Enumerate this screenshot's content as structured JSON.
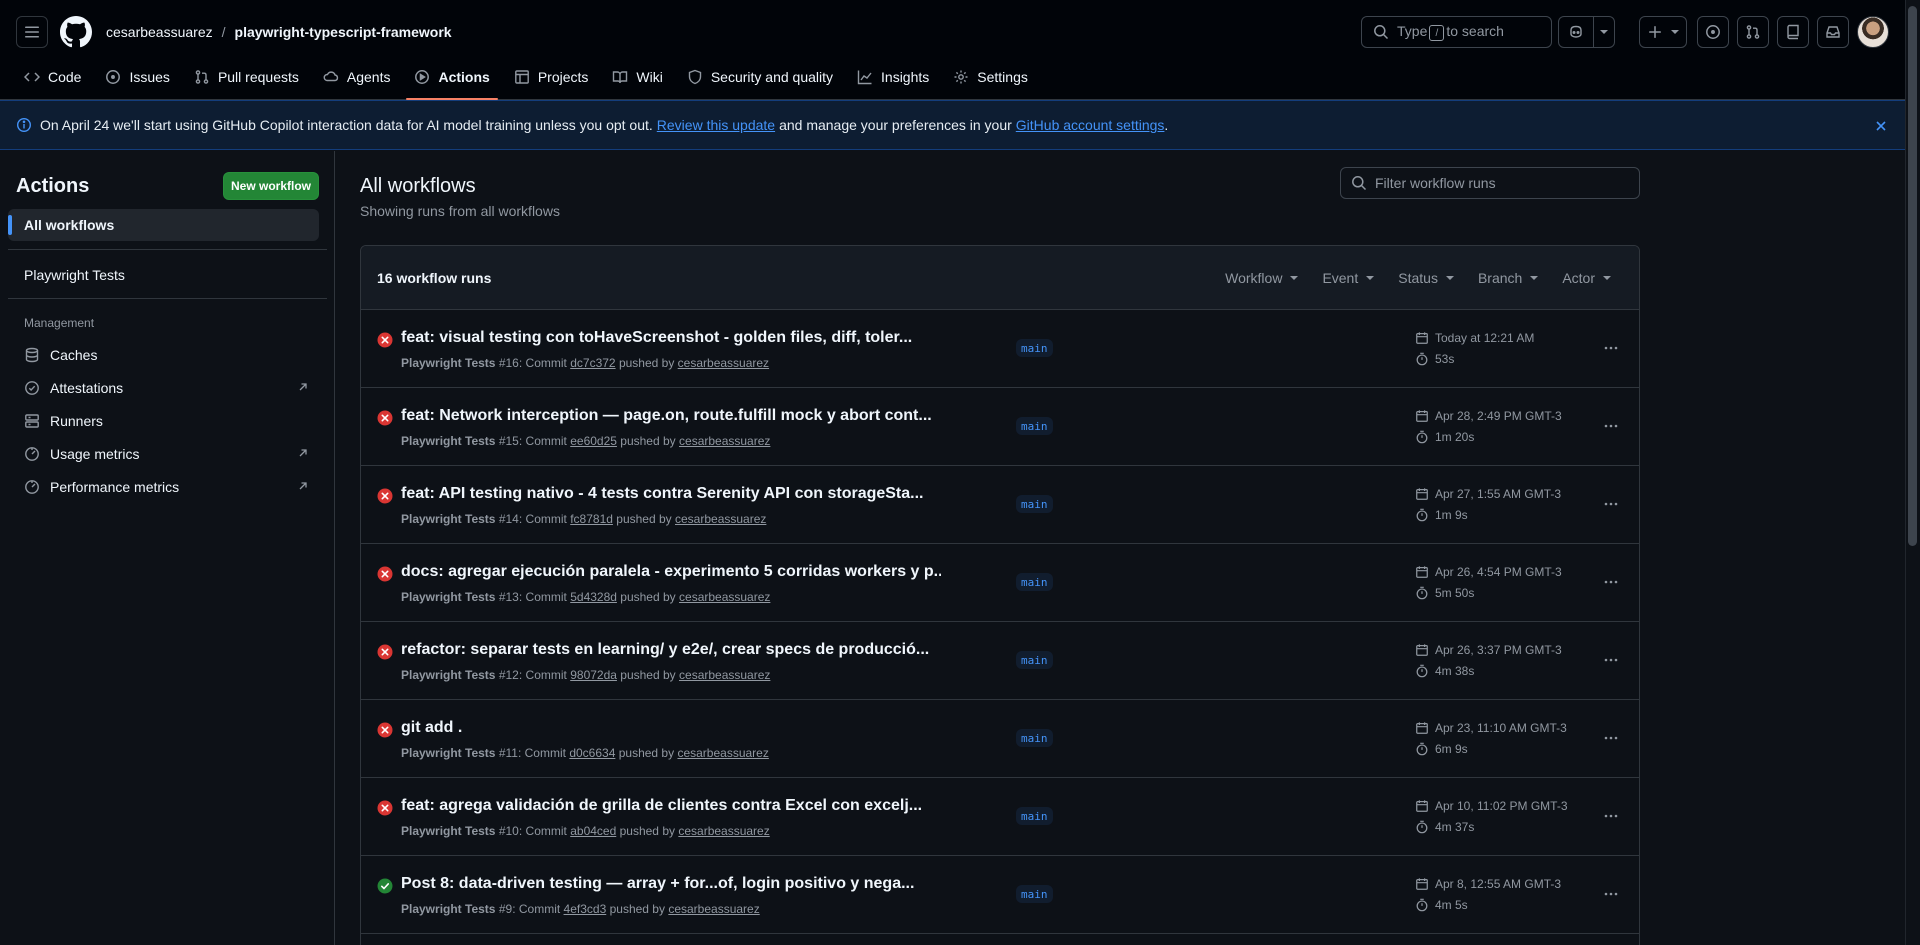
{
  "header": {
    "owner": "cesarbeassuarez",
    "separator": "/",
    "repo": "playwright-typescript-framework",
    "search_prefix": "Type",
    "search_key": "/",
    "search_suffix": "to search"
  },
  "nav": {
    "tabs": [
      {
        "label": "Code",
        "icon": "code-icon"
      },
      {
        "label": "Issues",
        "icon": "issue-icon"
      },
      {
        "label": "Pull requests",
        "icon": "pull-request-icon"
      },
      {
        "label": "Agents",
        "icon": "agent-icon"
      },
      {
        "label": "Actions",
        "icon": "play-icon",
        "active": true
      },
      {
        "label": "Projects",
        "icon": "table-icon"
      },
      {
        "label": "Wiki",
        "icon": "book-icon"
      },
      {
        "label": "Security and quality",
        "icon": "shield-icon"
      },
      {
        "label": "Insights",
        "icon": "graph-icon"
      },
      {
        "label": "Settings",
        "icon": "gear-icon"
      }
    ]
  },
  "banner": {
    "text_before": "On April 24 we'll start using GitHub Copilot interaction data for AI model training unless you opt out.",
    "link1": "Review this update",
    "text_middle": "and manage your preferences in your",
    "link2": "GitHub account settings",
    "text_after": "."
  },
  "sidebar": {
    "title": "Actions",
    "new_workflow": "New workflow",
    "all_workflows": "All workflows",
    "workflows": [
      "Playwright Tests"
    ],
    "group_label": "Management",
    "management": [
      {
        "label": "Caches",
        "icon": "database-icon",
        "external": false
      },
      {
        "label": "Attestations",
        "icon": "verified-icon",
        "external": true
      },
      {
        "label": "Runners",
        "icon": "server-icon",
        "external": false
      },
      {
        "label": "Usage metrics",
        "icon": "meter-icon",
        "external": true
      },
      {
        "label": "Performance metrics",
        "icon": "meter-icon",
        "external": true
      }
    ]
  },
  "main": {
    "title": "All workflows",
    "subtitle": "Showing runs from all workflows",
    "filter_placeholder": "Filter workflow runs",
    "runs_count": "16 workflow runs",
    "filters": [
      "Workflow",
      "Event",
      "Status",
      "Branch",
      "Actor"
    ],
    "runs": [
      {
        "status": "failure",
        "title": "feat: visual testing con toHaveScreenshot - golden files, diff, toler...",
        "workflow": "Playwright Tests",
        "number": "#16",
        "commit": "dc7c372",
        "user": "cesarbeassuarez",
        "branch": "main",
        "date": "Today at 12:21 AM",
        "duration": "53s"
      },
      {
        "status": "failure",
        "title": "feat: Network interception — page.on, route.fulfill mock y abort cont...",
        "workflow": "Playwright Tests",
        "number": "#15",
        "commit": "ee60d25",
        "user": "cesarbeassuarez",
        "branch": "main",
        "date": "Apr 28, 2:49 PM GMT-3",
        "duration": "1m 20s"
      },
      {
        "status": "failure",
        "title": "feat: API testing nativo - 4 tests contra Serenity API con storageSta...",
        "workflow": "Playwright Tests",
        "number": "#14",
        "commit": "fc8781d",
        "user": "cesarbeassuarez",
        "branch": "main",
        "date": "Apr 27, 1:55 AM GMT-3",
        "duration": "1m 9s"
      },
      {
        "status": "failure",
        "title": "docs: agregar ejecución paralela - experimento 5 corridas workers y p...",
        "workflow": "Playwright Tests",
        "number": "#13",
        "commit": "5d4328d",
        "user": "cesarbeassuarez",
        "branch": "main",
        "date": "Apr 26, 4:54 PM GMT-3",
        "duration": "5m 50s"
      },
      {
        "status": "failure",
        "title": "refactor: separar tests en learning/ y e2e/, crear specs de producció...",
        "workflow": "Playwright Tests",
        "number": "#12",
        "commit": "98072da",
        "user": "cesarbeassuarez",
        "branch": "main",
        "date": "Apr 26, 3:37 PM GMT-3",
        "duration": "4m 38s"
      },
      {
        "status": "failure",
        "title": "git add .",
        "workflow": "Playwright Tests",
        "number": "#11",
        "commit": "d0c6634",
        "user": "cesarbeassuarez",
        "branch": "main",
        "date": "Apr 23, 11:10 AM GMT-3",
        "duration": "6m 9s"
      },
      {
        "status": "failure",
        "title": "feat: agrega validación de grilla de clientes contra Excel con excelj...",
        "workflow": "Playwright Tests",
        "number": "#10",
        "commit": "ab04ced",
        "user": "cesarbeassuarez",
        "branch": "main",
        "date": "Apr 10, 11:02 PM GMT-3",
        "duration": "4m 37s"
      },
      {
        "status": "success",
        "title": "Post 8: data-driven testing — array + for...of, login positivo y nega...",
        "workflow": "Playwright Tests",
        "number": "#9",
        "commit": "4ef3cd3",
        "user": "cesarbeassuarez",
        "branch": "main",
        "date": "Apr 8, 12:55 AM GMT-3",
        "duration": "4m 5s"
      }
    ],
    "run_meta": {
      "commit_word": "Commit",
      "pushed_by": "pushed by"
    }
  },
  "colors": {
    "failure": "#da3633",
    "success": "#238636",
    "accent": "#4493f8"
  }
}
